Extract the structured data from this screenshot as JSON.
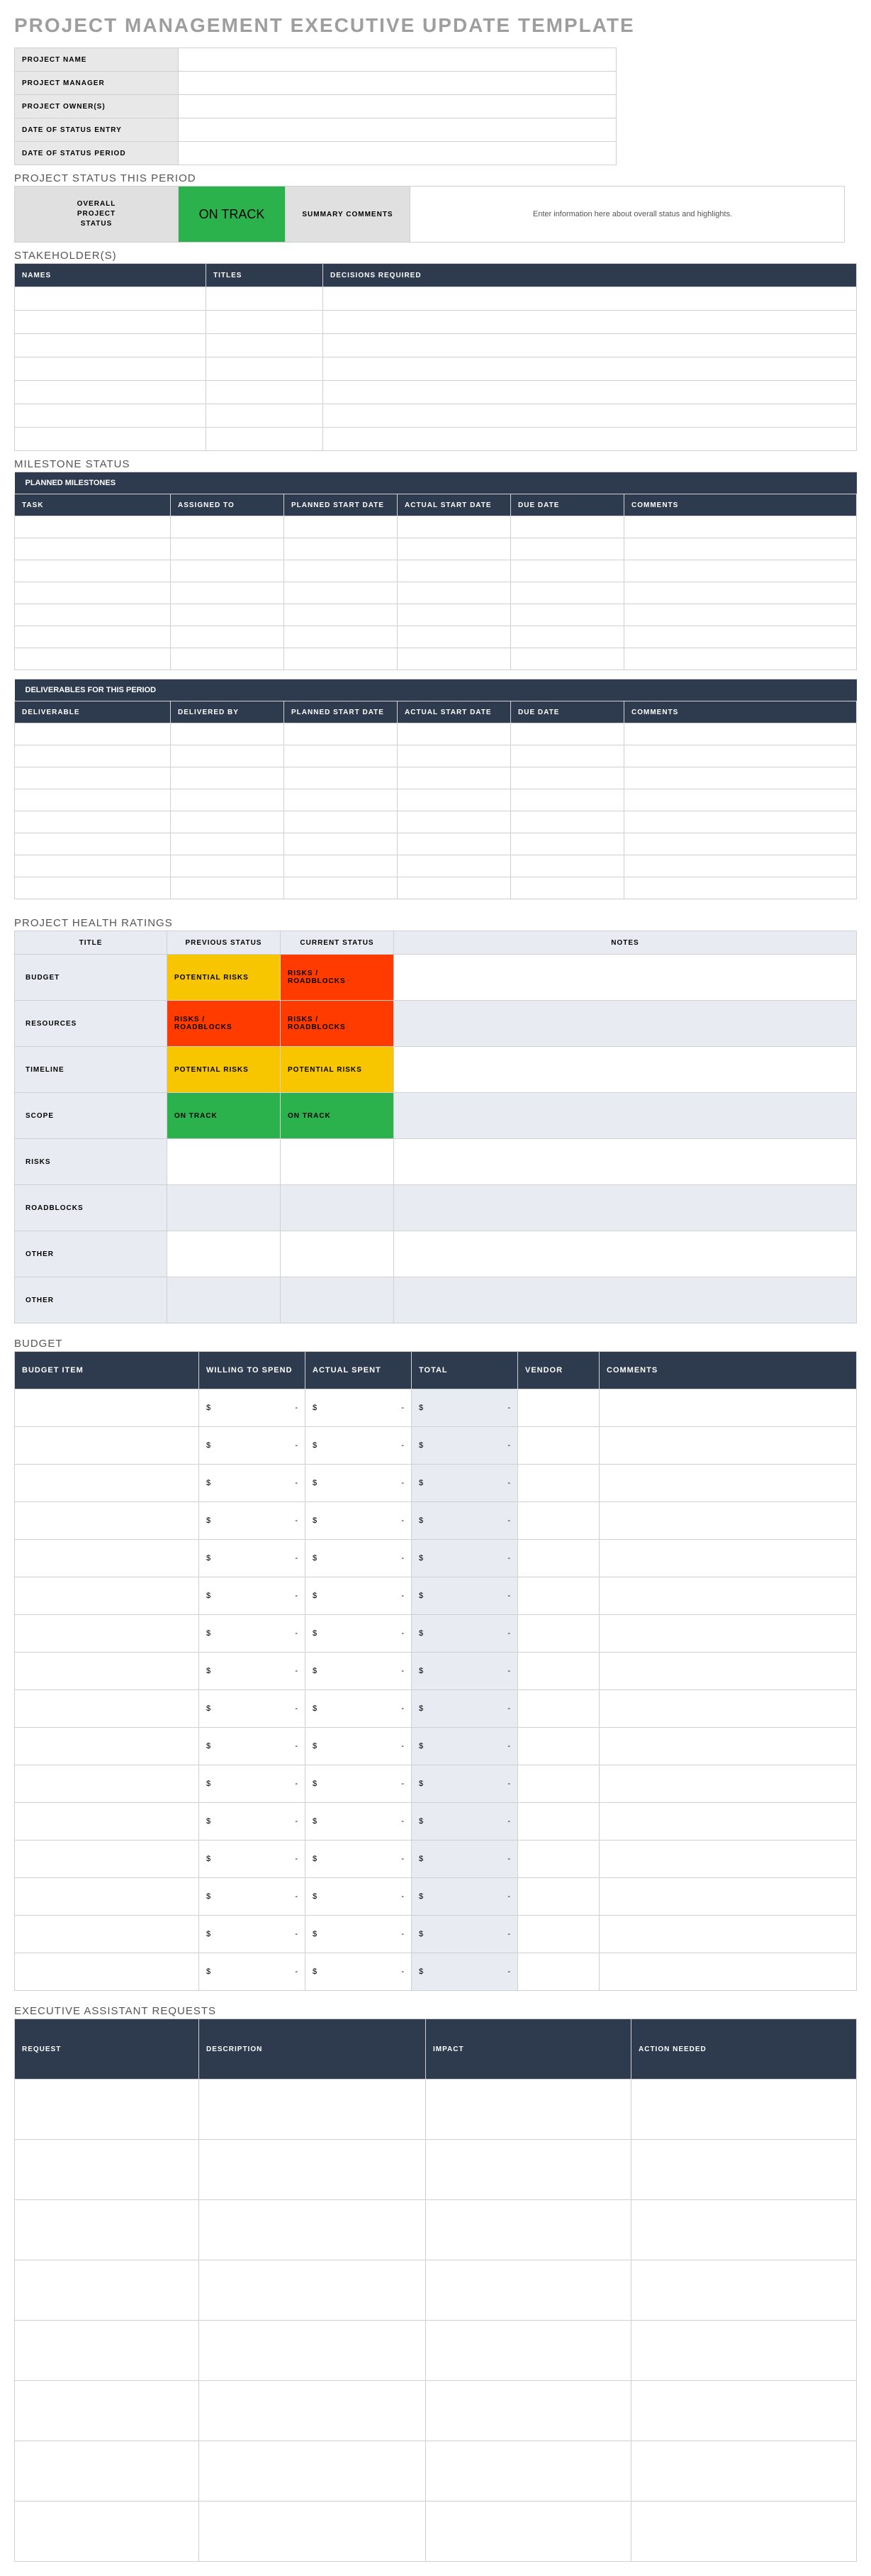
{
  "title": "PROJECT MANAGEMENT EXECUTIVE UPDATE TEMPLATE",
  "project_info": {
    "labels": [
      "PROJECT NAME",
      "PROJECT MANAGER",
      "PROJECT OWNER(S)",
      "DATE OF STATUS ENTRY",
      "DATE OF STATUS PERIOD"
    ],
    "values": [
      "",
      "",
      "",
      "",
      ""
    ]
  },
  "status_section_title": "PROJECT STATUS THIS PERIOD",
  "status_panel": {
    "overall_label": "OVERALL\nPROJECT\nSTATUS",
    "overall_status": "ON TRACK",
    "overall_color": "#2bb24c",
    "summary_label": "SUMMARY COMMENTS",
    "summary_value": "Enter information here about overall status and highlights."
  },
  "stakeholders": {
    "title": "STAKEHOLDER(S)",
    "headers": [
      "NAMES",
      "TITLES",
      "DECISIONS REQUIRED"
    ],
    "rows": 7
  },
  "milestone": {
    "title": "MILESTONE STATUS",
    "subheader": "PLANNED MILESTONES",
    "headers": [
      "TASK",
      "ASSIGNED TO",
      "PLANNED START DATE",
      "ACTUAL START DATE",
      "DUE DATE",
      "COMMENTS"
    ],
    "rows": 7
  },
  "deliverables": {
    "subheader": "DELIVERABLES FOR THIS PERIOD",
    "headers": [
      "DELIVERABLE",
      "DELIVERED BY",
      "PLANNED START DATE",
      "ACTUAL START DATE",
      "DUE DATE",
      "COMMENTS"
    ],
    "rows": 8
  },
  "health": {
    "title": "PROJECT HEALTH RATINGS",
    "headers": [
      "TITLE",
      "PREVIOUS STATUS",
      "CURRENT STATUS",
      "NOTES"
    ],
    "status_text": {
      "potential": "POTENTIAL RISKS",
      "risks": "RISKS / ROADBLOCKS",
      "ontrack": "ON TRACK"
    },
    "colors": {
      "potential": "#f7c600",
      "risks": "#ff3b00",
      "ontrack": "#2bb24c",
      "blank_white": "#ffffff",
      "blank_gray": "#e8ecf2"
    },
    "rows": [
      {
        "label": "BUDGET",
        "prev": "potential",
        "curr": "risks",
        "stripe": "white"
      },
      {
        "label": "RESOURCES",
        "prev": "risks",
        "curr": "risks",
        "stripe": "gray"
      },
      {
        "label": "TIMELINE",
        "prev": "potential",
        "curr": "potential",
        "stripe": "white"
      },
      {
        "label": "SCOPE",
        "prev": "ontrack",
        "curr": "ontrack",
        "stripe": "gray"
      },
      {
        "label": "RISKS",
        "prev": "",
        "curr": "",
        "stripe": "white"
      },
      {
        "label": "ROADBLOCKS",
        "prev": "",
        "curr": "",
        "stripe": "gray"
      },
      {
        "label": "OTHER",
        "prev": "",
        "curr": "",
        "stripe": "white"
      },
      {
        "label": "OTHER",
        "prev": "",
        "curr": "",
        "stripe": "gray"
      }
    ]
  },
  "budget": {
    "title": "BUDGET",
    "headers": [
      "BUDGET ITEM",
      "WILLING TO SPEND",
      "ACTUAL SPENT",
      "TOTAL",
      "VENDOR",
      "COMMENTS"
    ],
    "rows": 16
  },
  "requests": {
    "title": "EXECUTIVE ASSISTANT REQUESTS",
    "headers": [
      "REQUEST",
      "DESCRIPTION",
      "IMPACT",
      "ACTION NEEDED"
    ],
    "rows": 8
  }
}
